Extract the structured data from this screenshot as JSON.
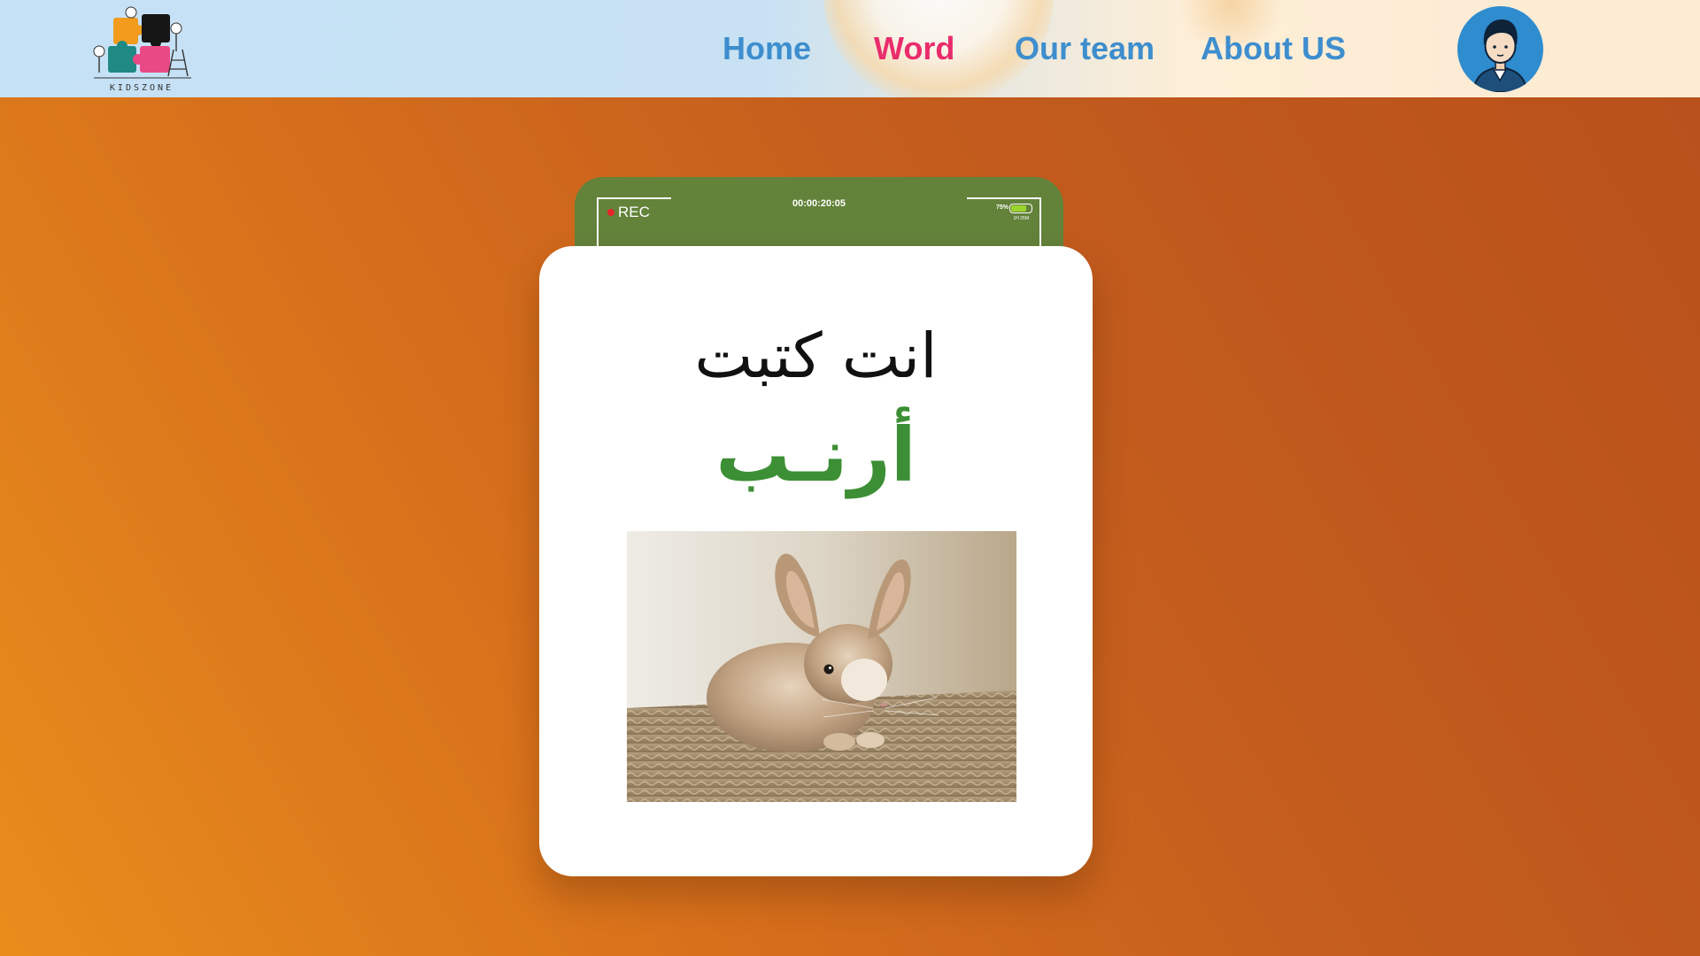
{
  "header": {
    "logo_text": "KIDSZONE",
    "nav": [
      {
        "label": "Home",
        "active": false
      },
      {
        "label": "Word",
        "active": true
      },
      {
        "label": "Our team",
        "active": false
      },
      {
        "label": "About US",
        "active": false
      }
    ]
  },
  "card": {
    "rec_label": "REC",
    "timer": "00:00:20:05",
    "battery_percent": "75%",
    "battery_level": 0.75,
    "battery_sub": "1H 25M",
    "line1": "انت كتبت",
    "line2": "أرنـب"
  },
  "colors": {
    "nav_default": "#3e8ece",
    "nav_active": "#ea2c6c",
    "word_green": "#3d8f35",
    "camera_frame": "#63823a",
    "avatar_bg": "#2f8cce"
  }
}
